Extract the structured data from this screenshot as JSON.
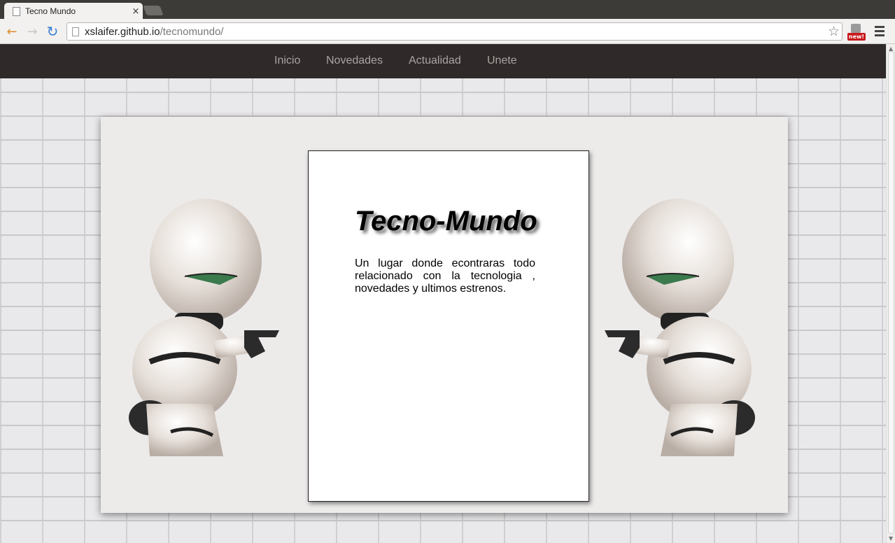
{
  "browser": {
    "tab_title": "Tecno Mundo",
    "tab_close_glyph": "×",
    "url_host": "xslaifer.github.io",
    "url_path": "/tecnomundo/",
    "extension_badge": "new!"
  },
  "nav": {
    "items": [
      "Inicio",
      "Novedades",
      "Actualidad",
      "Unete"
    ]
  },
  "hero": {
    "title": "Tecno-Mundo",
    "description": "Un lugar donde econtraras todo relacionado con la tecnologia , novedades y ultimos estrenos."
  },
  "icons": {
    "back": "back-arrow-icon",
    "forward": "forward-arrow-icon",
    "reload": "reload-icon",
    "bookmark": "star-icon",
    "menu": "hamburger-menu-icon"
  },
  "colors": {
    "navbar_bg": "#2f2a29",
    "nav_text": "#a9a4a2",
    "panel_bg": "#edeaea"
  }
}
